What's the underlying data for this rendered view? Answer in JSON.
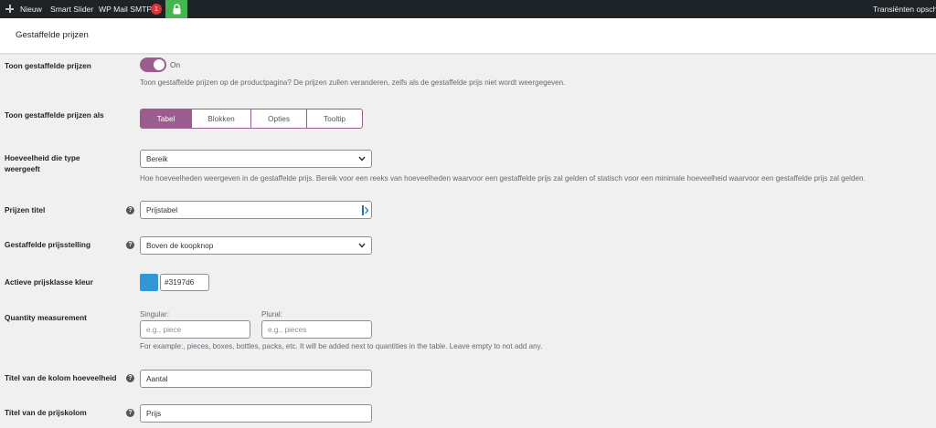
{
  "adminbar": {
    "new_label": "Nieuw",
    "smart_slider": "Smart Slider",
    "wp_mail_smtp": "WP Mail SMTP",
    "smtp_badge": "1",
    "right_text": "Transiënten opsch"
  },
  "header": {
    "title": "Gestaffelde prijzen"
  },
  "show_tiered": {
    "label": "Toon gestaffelde prijzen",
    "toggle_state": "On",
    "description": "Toon gestaffelde prijzen op de productpagina? De prijzen zullen veranderen, zelfs als de gestaffelde prijs niet wordt weergegeven."
  },
  "display_as": {
    "label": "Toon gestaffelde prijzen als",
    "options": [
      "Tabel",
      "Blokken",
      "Opties",
      "Tooltip"
    ],
    "selected": "Tabel"
  },
  "quantity_type": {
    "label_line1": "Hoeveelheid die type",
    "label_line2": "weergeeft",
    "value": "Bereik",
    "description": "Hoe hoeveelheden weergeven in de gestaffelde prijs. Bereik voor een reeks van hoeveelheden waarvoor een gestaffelde prijs zal gelden of statisch voor een minimale hoeveelheid waarvoor een gestaffelde prijs zal gelden."
  },
  "prices_title": {
    "label": "Prijzen titel",
    "value": "Prijstabel"
  },
  "position": {
    "label": "Gestaffelde prijsstelling",
    "value": "Boven de koopknop"
  },
  "active_color": {
    "label": "Actieve prijsklasse kleur",
    "value": "#3197d6",
    "swatch_color": "#3197d6"
  },
  "quantity_measurement": {
    "label": "Quantity measurement",
    "singular_label": "Singular:",
    "singular_placeholder": "e.g., piece",
    "plural_label": "Plural:",
    "plural_placeholder": "e.g., pieces",
    "description": "For example:, pieces, boxes, bottles, packs, etc. It will be added next to quantities in the table. Leave empty to not add any."
  },
  "quantity_column": {
    "label": "Titel van de kolom hoeveelheid",
    "value": "Aantal"
  },
  "price_column": {
    "label": "Titel van de prijskolom",
    "value": "Prijs"
  },
  "help_glyph": "?",
  "colors": {
    "accent": "#9b5c8f",
    "adminbar": "#1d2327",
    "lock_green": "#46b450"
  }
}
